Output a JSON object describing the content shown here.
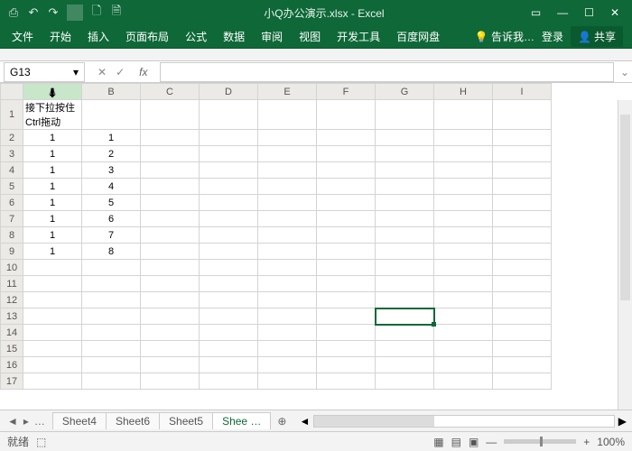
{
  "title": "小Q办公演示.xlsx - Excel",
  "qat": {
    "save": "⎙",
    "undo": "↶",
    "redo": "↷",
    "new": "🗋",
    "print": "🗎"
  },
  "win": {
    "opts": "▭",
    "min": "—",
    "max": "☐",
    "close": "✕"
  },
  "tabs": [
    "文件",
    "开始",
    "插入",
    "页面布局",
    "公式",
    "数据",
    "审阅",
    "视图",
    "开发工具",
    "百度网盘"
  ],
  "tell": "告诉我…",
  "login": "登录",
  "share": "共享",
  "namebox": "G13",
  "fx": "fx",
  "cols": [
    "A",
    "B",
    "C",
    "D",
    "E",
    "F",
    "G",
    "H",
    "I"
  ],
  "rows": [
    1,
    2,
    3,
    4,
    5,
    6,
    7,
    8,
    9,
    10,
    11,
    12,
    13,
    14,
    15,
    16,
    17
  ],
  "cells": {
    "A1": "接下拉按住Ctrl拖动",
    "A2": "1",
    "B2": "1",
    "A3": "1",
    "B3": "2",
    "A4": "1",
    "B4": "3",
    "A5": "1",
    "B5": "4",
    "A6": "1",
    "B6": "5",
    "A7": "1",
    "B7": "6",
    "A8": "1",
    "B8": "7",
    "A9": "1",
    "B9": "8"
  },
  "sheets": [
    "Sheet4",
    "Sheet6",
    "Sheet5",
    "Shee …"
  ],
  "sheetNav": {
    "first": "◄",
    "prev": "▸",
    "dots": "…",
    "plus": "⊕"
  },
  "status": {
    "ready": "就绪",
    "rec": "⬚",
    "views": [
      "▦",
      "▤",
      "▣"
    ],
    "zm": "—",
    "zp": "+",
    "zoom": "100%"
  }
}
